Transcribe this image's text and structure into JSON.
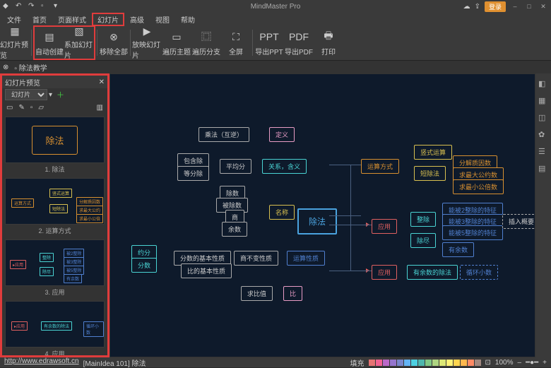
{
  "app": {
    "title": "MindMaster Pro"
  },
  "titlebar": {
    "login_label": "登录"
  },
  "menu": {
    "items": [
      "文件",
      "首页",
      "页面样式",
      "幻灯片",
      "高级",
      "视图",
      "帮助"
    ],
    "active_index": 3
  },
  "ribbon": {
    "groups": [
      {
        "buttons": [
          {
            "label": "幻灯片预览",
            "icon": "▦"
          }
        ]
      },
      {
        "buttons": [
          {
            "label": "自动创建",
            "icon": "▤"
          },
          {
            "label": "系加幻灯片",
            "icon": "▧"
          }
        ],
        "highlight": true
      },
      {
        "buttons": [
          {
            "label": "移除全部",
            "icon": "⊗"
          }
        ]
      },
      {
        "buttons": [
          {
            "label": "放映幻灯片",
            "icon": "▶"
          },
          {
            "label": "遍历主题",
            "icon": "▭"
          },
          {
            "label": "遍历分支",
            "icon": "⿴"
          },
          {
            "label": "全屏",
            "icon": "⛶"
          }
        ]
      },
      {
        "buttons": [
          {
            "label": "导出PPT",
            "icon": "PPT"
          },
          {
            "label": "导出PDF",
            "icon": "PDF"
          },
          {
            "label": "打印",
            "icon": "🖶"
          }
        ]
      }
    ]
  },
  "sidepanel": {
    "title": "幻灯片预览",
    "selector": "幻灯片 2",
    "slides": [
      {
        "label": "1. 除法",
        "content": "除法"
      },
      {
        "label": "2. 运算方式"
      },
      {
        "label": "3. 应用"
      },
      {
        "label": "4. 应用"
      }
    ]
  },
  "tab": {
    "name": "除法教学"
  },
  "canvas": {
    "center": "除法",
    "nodes": {
      "dingyi": "定义",
      "chengfa": "乘法（互逆）",
      "baohanchu": "包含除",
      "dengfenchu": "等分除",
      "pingjunfen": "平均分",
      "guanxi": "关系，含义",
      "chushu": "除数",
      "beichushu": "被除数",
      "shang": "商",
      "yushu": "余数",
      "mingcheng": "名称",
      "yunsuanfangshi": "运算方式",
      "shushi": "竖式运算",
      "duanchu": "短除法",
      "fenjie": "分解质因数",
      "gongyue": "求最大公约数",
      "gongbei": "求最小公倍数",
      "yingyong1": "应用",
      "zhengchu": "整除",
      "chujin": "除尽",
      "tz2": "能被2整除的特征",
      "tz3": "能被3整除的特征",
      "tz5": "能被5整除的特征",
      "charu": "插入概要",
      "youyushu": "有余数",
      "yingyong2": "应用",
      "youyuchufa": "有余数的除法",
      "xunhuan": "循环小数",
      "yuefen": "约分",
      "fenshu": "分数",
      "fsjb": "分数的基本性质",
      "sbb": "商不变性质",
      "ysxz": "运算性质",
      "bijb": "比的基本性质",
      "qiubi": "求比值",
      "bi": "比"
    }
  },
  "statusbar": {
    "link": "http://www.edrawsoft.cn",
    "info": "[MainIdea 101]  除法",
    "fill_label": "填充",
    "zoom": "100%",
    "colors": [
      "#e57373",
      "#f06292",
      "#ba68c8",
      "#9575cd",
      "#7986cb",
      "#64b5f6",
      "#4dd0e1",
      "#4db6ac",
      "#81c784",
      "#aed581",
      "#dce775",
      "#fff176",
      "#ffd54f",
      "#ffb74d",
      "#ff8a65",
      "#a1887f"
    ]
  }
}
